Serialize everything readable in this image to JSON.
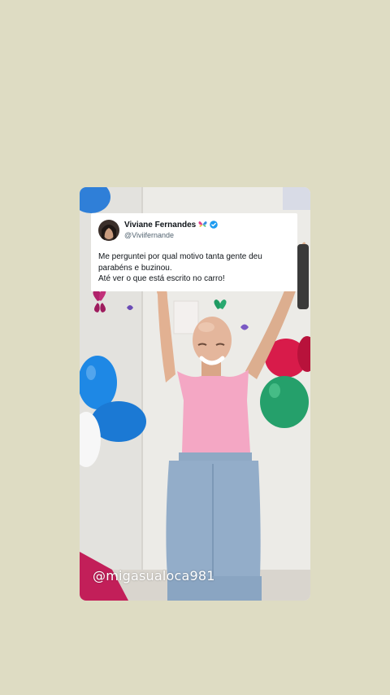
{
  "tweet": {
    "display_name": "Viviane Fernandes",
    "handle": "@Viviifernande",
    "lines": [
      "Me perguntei por qual motivo tanta gente deu",
      "parabéns e buzinou.",
      "Até ver o que está escrito no carro!"
    ]
  },
  "watermark": "@migasualoca981",
  "icons": {
    "verified": "verified-badge-icon",
    "name_emoji": "butterfly-emoji-icon"
  },
  "colors": {
    "background": "#dedcc3",
    "verified": "#1d9bf0",
    "balloon_blue": "#1e88e5",
    "balloon_green": "#25a06b",
    "balloon_red": "#d81b4a",
    "top_pink": "#f4a7c4"
  }
}
